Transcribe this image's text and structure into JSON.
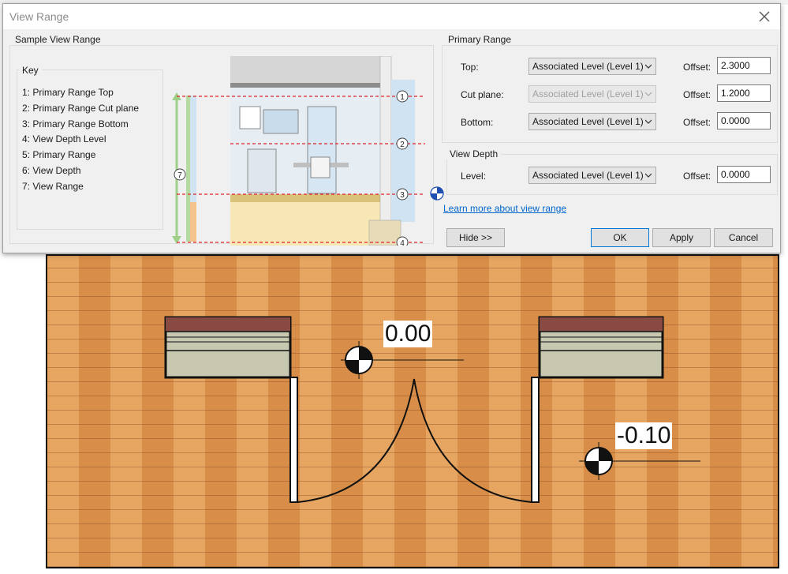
{
  "dialog": {
    "title": "View Range",
    "sample": {
      "group_title": "Sample View Range",
      "key_title": "Key",
      "key_items": [
        "1: Primary Range Top",
        "2: Primary Range Cut plane",
        "3: Primary Range Bottom",
        "4: View Depth Level",
        "5: Primary Range",
        "6: View Depth",
        "7: View Range"
      ],
      "markers": [
        "1",
        "2",
        "3",
        "4",
        "7"
      ]
    },
    "primary_range": {
      "group_title": "Primary Range",
      "rows": [
        {
          "label": "Top:",
          "value": "Associated Level (Level 1)",
          "offset_label": "Offset:",
          "offset": "2.3000",
          "disabled": false
        },
        {
          "label": "Cut plane:",
          "value": "Associated Level (Level 1)",
          "offset_label": "Offset:",
          "offset": "1.2000",
          "disabled": true
        },
        {
          "label": "Bottom:",
          "value": "Associated Level (Level 1)",
          "offset_label": "Offset:",
          "offset": "0.0000",
          "disabled": false
        }
      ]
    },
    "view_depth": {
      "group_title": "View Depth",
      "row": {
        "label": "Level:",
        "value": "Associated Level (Level 1)",
        "offset_label": "Offset:",
        "offset": "0.0000"
      }
    },
    "learn_more": "Learn more about view range",
    "buttons": {
      "hide": "Hide >>",
      "ok": "OK",
      "apply": "Apply",
      "cancel": "Cancel"
    }
  },
  "view": {
    "elevations": [
      "0.00",
      "-0.10"
    ]
  },
  "colors": {
    "floor": "#e09a52",
    "dialog_bg": "#f0f0f0",
    "link": "#0066cc",
    "range_line": "#e0242a"
  }
}
